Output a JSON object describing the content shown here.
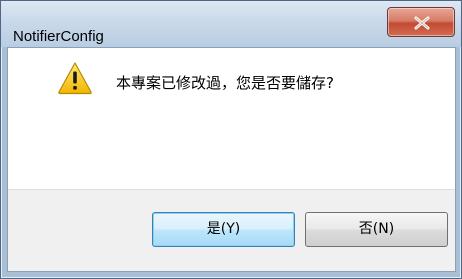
{
  "window": {
    "title": "NotifierConfig"
  },
  "dialog": {
    "icon": "warning-icon",
    "message": "本專案已修改過，您是否要儲存?"
  },
  "buttons": {
    "yes_label": "是(Y)",
    "no_label": "否(N)"
  },
  "colors": {
    "titlebar": "#c9d9ea",
    "close_button": "#c24b33",
    "footer": "#f0f0f0",
    "default_button_border": "#3c7fb1",
    "warning_yellow": "#f5c400"
  }
}
